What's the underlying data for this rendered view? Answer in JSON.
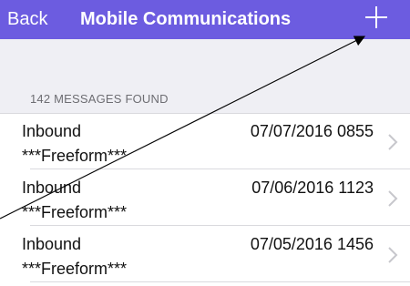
{
  "navbar": {
    "back_label": "Back",
    "title": "Mobile Communications",
    "add_icon": "plus-icon",
    "color": "#6c5ce0"
  },
  "list": {
    "count_header": "142 MESSAGES FOUND",
    "items": [
      {
        "direction": "Inbound",
        "type": "***Freeform***",
        "datetime": "07/07/2016 0855"
      },
      {
        "direction": "Inbound",
        "type": "***Freeform***",
        "datetime": "07/06/2016 1123"
      },
      {
        "direction": "Inbound",
        "type": "***Freeform***",
        "datetime": "07/05/2016 1456"
      }
    ],
    "chevron_icon": "chevron-right-icon"
  }
}
